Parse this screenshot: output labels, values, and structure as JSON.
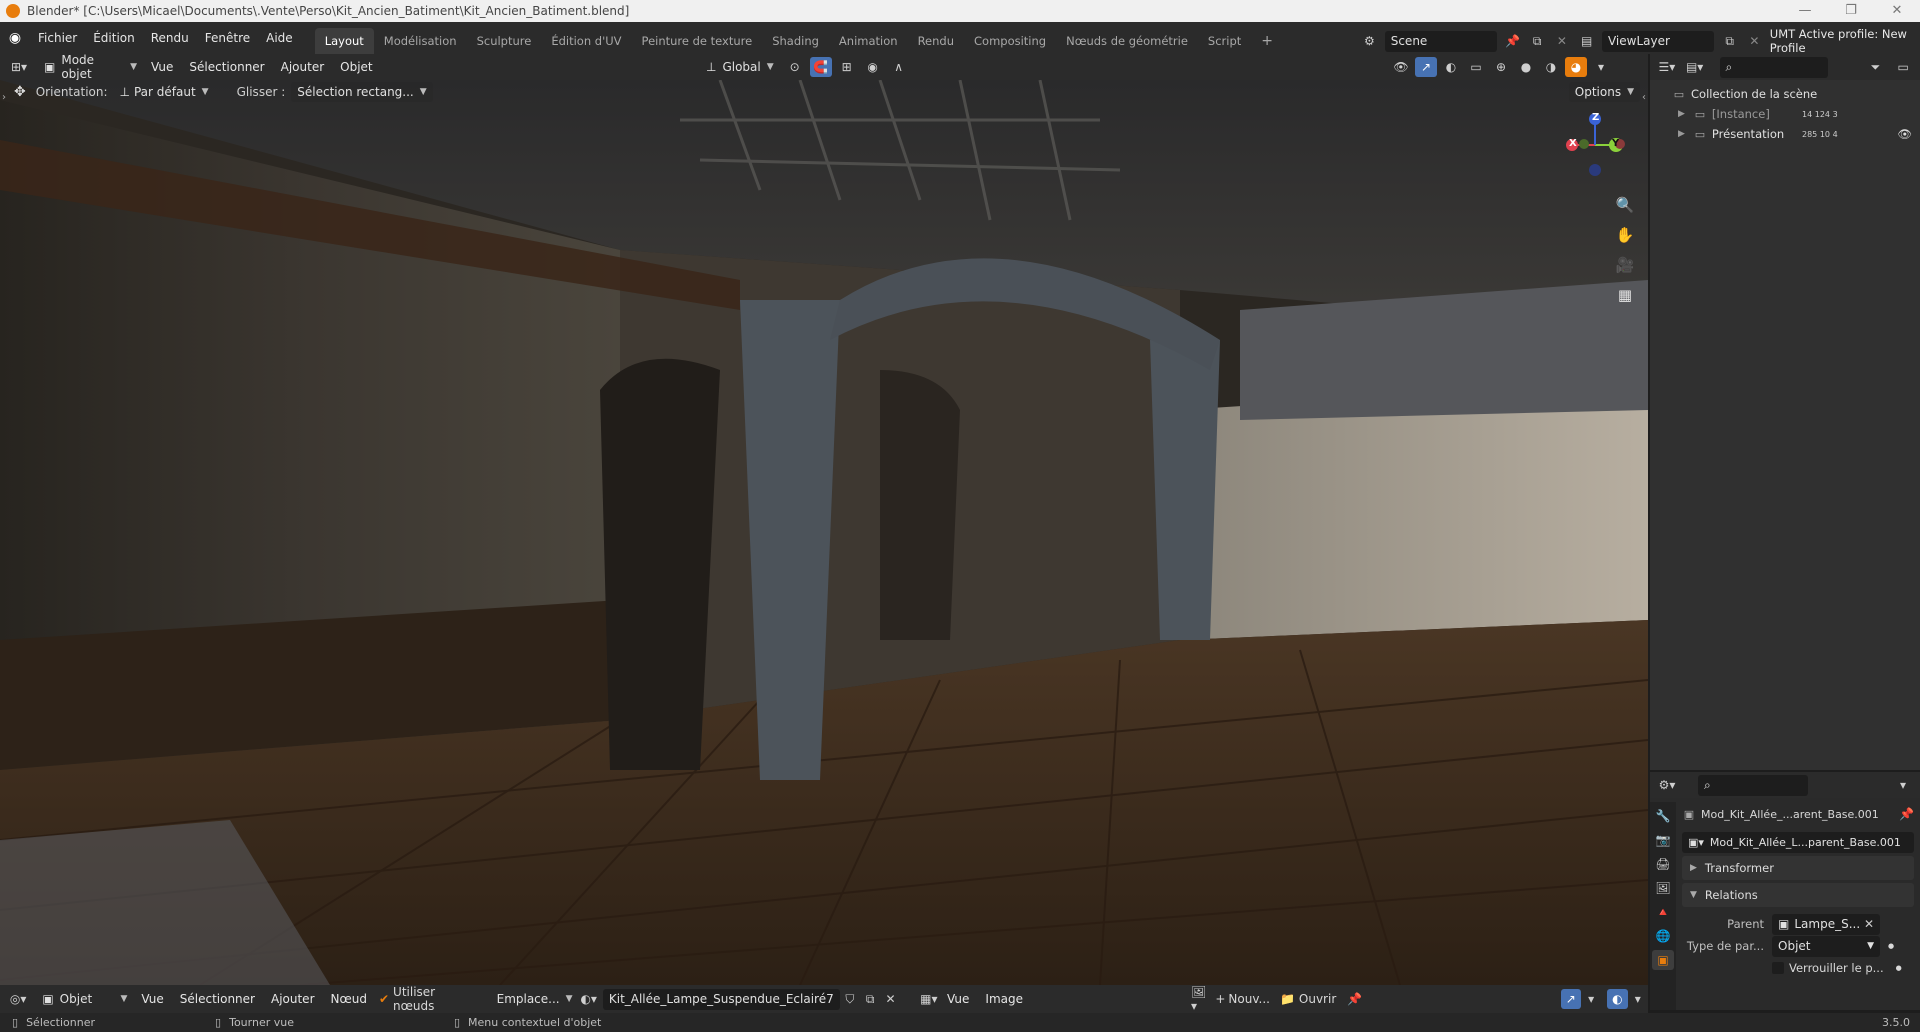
{
  "titlebar": {
    "title": "Blender* [C:\\Users\\Micael\\Documents\\.Vente\\Perso\\Kit_Ancien_Batiment\\Kit_Ancien_Batiment.blend]",
    "minimize": "—",
    "maximize": "❐",
    "close": "✕"
  },
  "menu": {
    "items": [
      "Fichier",
      "Édition",
      "Rendu",
      "Fenêtre",
      "Aide"
    ],
    "workspaces": [
      "Layout",
      "Modélisation",
      "Sculpture",
      "Édition d'UV",
      "Peinture de texture",
      "Shading",
      "Animation",
      "Rendu",
      "Compositing",
      "Nœuds de géométrie",
      "Script"
    ],
    "active_workspace": "Layout",
    "add_tab": "+",
    "scene": "Scene",
    "view_layer": "ViewLayer",
    "umt_label": "UMT Active profile: New Profile"
  },
  "viewport_header": {
    "mode": "Mode objet",
    "menus": [
      "Vue",
      "Sélectionner",
      "Ajouter",
      "Objet"
    ],
    "transform": "Global",
    "orientation_label": "Orientation:",
    "orientation_value": "Par défaut",
    "drag_label": "Glisser :",
    "drag_value": "Sélection rectang...",
    "options": "Options"
  },
  "outliner": {
    "root": "Collection de la scène",
    "rows": [
      {
        "label": "[Instance]",
        "counts": [
          "14",
          "124",
          "3"
        ]
      },
      {
        "label": "Présentation",
        "counts": [
          "285",
          "10",
          "4"
        ]
      }
    ]
  },
  "properties": {
    "object_name": "Mod_Kit_Allée_...arent_Base.001",
    "data_name": "Mod_Kit_Allée_L...parent_Base.001",
    "panels": {
      "transform": "Transformer",
      "relations": "Relations"
    },
    "parent_label": "Parent",
    "parent_value": "Lampe_S...",
    "parent_type_label": "Type de par...",
    "parent_type_value": "Objet",
    "lock_label": "Verrouiller le p..."
  },
  "bottom_editor": {
    "object_label": "Objet",
    "menus": [
      "Vue",
      "Sélectionner",
      "Ajouter",
      "Nœud"
    ],
    "use_nodes": "Utiliser nœuds",
    "slot": "Emplace...",
    "material": "Kit_Allée_Lampe_Suspendue_Eclairé",
    "user_count": "7",
    "image_menus": [
      "Vue",
      "Image"
    ],
    "new_label": "Nouv...",
    "open_label": "Ouvrir"
  },
  "statusbar": {
    "select": "Sélectionner",
    "rotate": "Tourner vue",
    "context": "Menu contextuel d'objet",
    "version": "3.5.0"
  },
  "gizmo": {
    "x": "X",
    "y": "Y",
    "z": "Z"
  },
  "colors": {
    "accent": "#4772b3",
    "blender_orange": "#e87d0d",
    "axis_x": "#e0414f",
    "axis_y": "#8bd13b",
    "axis_z": "#3a63d6"
  }
}
